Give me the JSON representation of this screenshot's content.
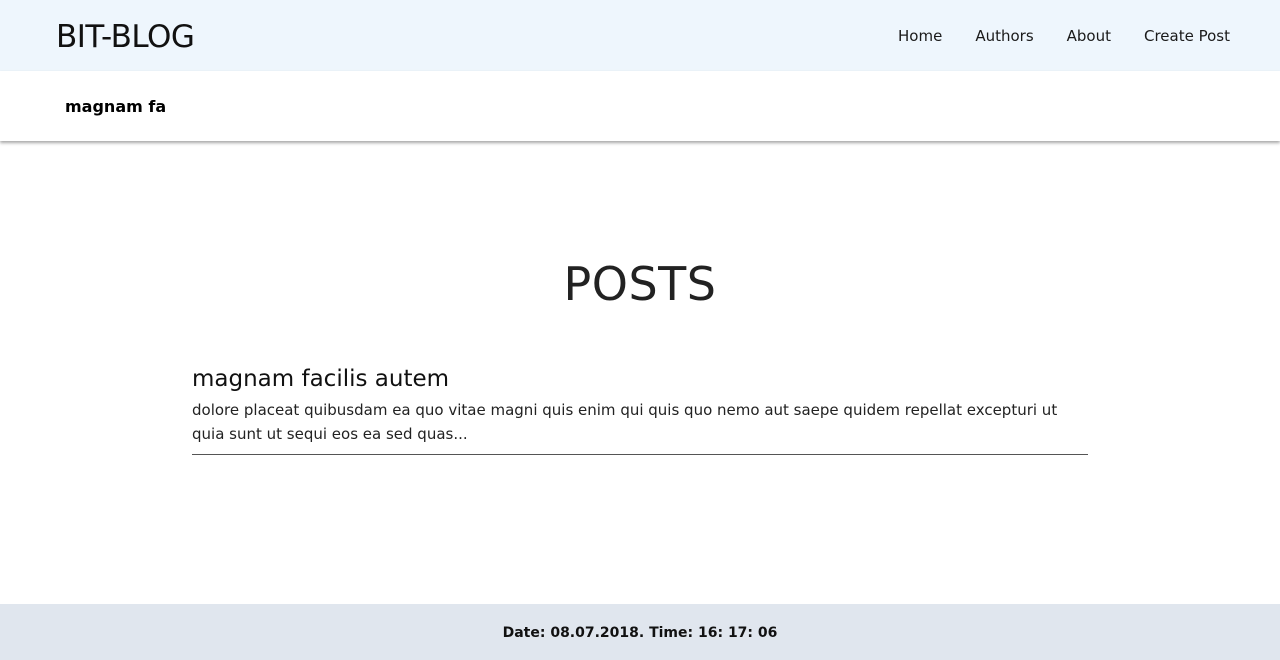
{
  "header": {
    "brand": "BIT-BLOG",
    "nav": [
      {
        "label": "Home"
      },
      {
        "label": "Authors"
      },
      {
        "label": "About"
      },
      {
        "label": "Create Post"
      }
    ]
  },
  "subbar": {
    "title": "magnam fa"
  },
  "main": {
    "heading": "POSTS",
    "posts": [
      {
        "title": "magnam facilis autem",
        "excerpt": "dolore placeat quibusdam ea quo vitae magni quis enim qui quis quo nemo aut saepe quidem repellat excepturi ut quia sunt ut sequi eos ea sed quas..."
      }
    ]
  },
  "footer": {
    "datetime": "Date: 08.07.2018. Time: 16: 17: 06"
  },
  "colors": {
    "header_bg": "#eef6fd",
    "footer_bg": "#e0e6ee",
    "divider": "#555555"
  }
}
